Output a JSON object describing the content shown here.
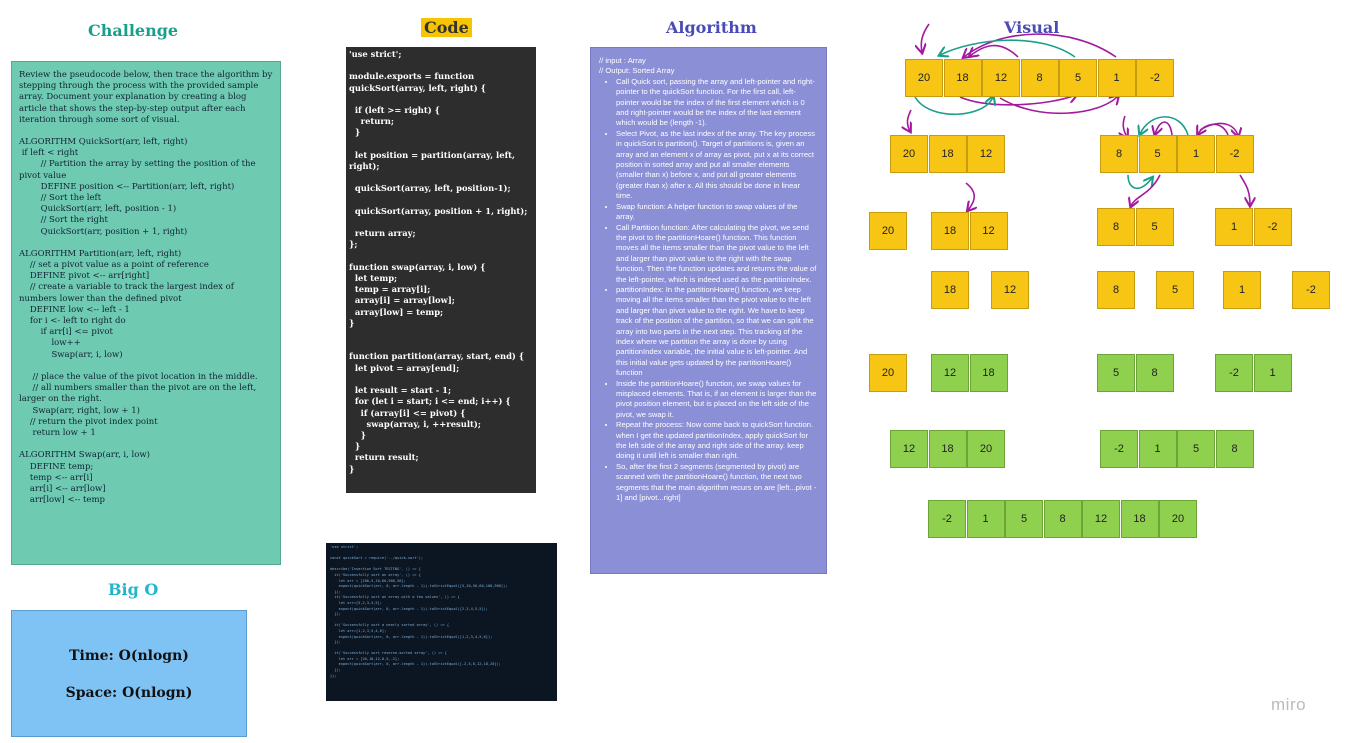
{
  "headings": {
    "challenge": "Challenge",
    "code": "Code",
    "algorithm": "Algorithm",
    "visual": "Visual",
    "bigo": "Big O"
  },
  "challenge": {
    "intro": "Review the pseudocode below, then trace the algorithm by stepping through the process with the provided sample array. Document your explanation by creating a blog article that shows the step-by-step output after each iteration through some sort of visual.",
    "quicksort": "ALGORITHM QuickSort(arr, left, right)\n if left < right\n        // Partition the array by setting the position of the pivot value\n        DEFINE position <-- Partition(arr, left, right)\n        // Sort the left\n        QuickSort(arr, left, position - 1)\n        // Sort the right\n        QuickSort(arr, position + 1, right)",
    "partition": "ALGORITHM Partition(arr, left, right)\n    // set a pivot value as a point of reference\n    DEFINE pivot <-- arr[right]\n    // create a variable to track the largest index of numbers lower than the defined pivot\n    DEFINE low <-- left - 1\n    for i <- left to right do\n        if arr[i] <= pivot\n            low++\n            Swap(arr, i, low)\n\n     // place the value of the pivot location in the middle.\n     // all numbers smaller than the pivot are on the left, larger on the right.\n     Swap(arr, right, low + 1)\n    // return the pivot index point\n     return low + 1",
    "swap": "ALGORITHM Swap(arr, i, low)\n    DEFINE temp;\n    temp <-- arr[i]\n    arr[i] <-- arr[low]\n    arr[low] <-- temp"
  },
  "bigo": {
    "time": "Time: O(nlogn)",
    "space": "Space: O(nlogn)"
  },
  "code": "'use strict';\n\nmodule.exports = function quickSort(array, left, right) {\n\n  if (left >= right) {\n    return;\n  }\n\n  let position = partition(array, left, right);\n\n  quickSort(array, left, position-1);\n\n  quickSort(array, position + 1, right);\n\n  return array;\n};\n\nfunction swap(array, i, low) {\n  let temp;\n  temp = array[i];\n  array[i] = array[low];\n  array[low] = temp;\n}\n\n\nfunction partition(array, start, end) {\n  let pivot = array[end];\n\n  let result = start - 1;\n  for (let i = start; i <= end; i++) {\n    if (array[i] <= pivot) {\n      swap(array, i, ++result);\n    }\n  }\n  return result;\n}",
  "test_code": "'use strict';\n\nconst quickSort = require('../quick-sort');\n\ndescribe('Insertion Sort TESTING', () => {\n  it('Successfully sort an array', () => {\n    let arr = [100,5,10,60,900,50];\n    expect(quickSort(arr, 0, arr.length - 1)).toStrictEqual([5,10,50,60,100,900]);\n  });\n  it('Successfully sort an array with a few values', () => {\n    let arr=[5,2,3,4,5];\n    expect(quickSort(arr, 0, arr.length - 1)).toStrictEqual([2,3,4,5,5]);\n  });\n\n  it('Successfully sort a nearly sorted array', () => {\n    let arr=[1,2,3,5,4,6];\n    expect(quickSort(arr, 0, arr.length - 1)).toStrictEqual([1,2,3,4,5,6]);\n  });\n\n  it('Successfully sort reverse-sorted array', () => {\n    let arr = [20,18,12,8,5,-2];\n    expect(quickSort(arr, 0, arr.length - 1)).toStrictEqual([-2,5,8,12,18,20]);\n  });\n});",
  "algorithm": {
    "input": "// input : Array",
    "output": "// Output: Sorted Array",
    "steps": [
      "Call Quick sort, passing the array and left-pointer and right-pointer to the quickSort function. For the first call, left-pointer would be the index of the first element which is 0 and right-pointer would be the index of the last element which would be (length -1).",
      "Select Pivot, as the last index of the array. The key process in quickSort is partition(). Target of partitions is, given an array and an element x of array as pivot, put x at its correct position in sorted array and put all smaller elements (smaller than x) before x, and put all greater elements (greater than x) after x. All this should be done in linear time.",
      "Swap function: A helper function to swap values of the array.",
      "Call Partition function: After calculating the pivot, we send the pivot to the partitionHoare() function. This function moves all the items smaller than the pivot value to the left and larger than pivot value to the right with the swap function. Then the function updates and returns the value of the left-pointer, which is indeed used as the partitionIndex.",
      "partitionIndex: In the partitionHoare() function, we keep moving all the items smaller than the pivot value to the left and larger than pivot value to the right. We have to keep track of the position of the partition, so that we can split the array into two parts in the next step. This tracking of the index where we partition the array is done by using partitionIndex variable, the initial value is left-pointer. And this initial value gets updated by the partitionHoare() function",
      "Inside the partitionHoare() function, we swap values for misplaced elements. That is, if an element is larger than the pivot position element, but is placed on the left side of the pivot, we swap it.",
      "Repeat the process: Now come back to quickSort function. when I get the updated partitionIndex, apply quickSort for the left side of the array and right side of the array. keep doing it until left is smaller than right.",
      "So, after the first 2 segments (segmented by pivot) are scanned with the partitionHoare() function, the next two segments that the main algorithm recurs on are [left...pivot - 1] and [pivot...right]"
    ]
  },
  "visual": {
    "colors": {
      "yellow": "#f7c514",
      "green": "#8fd14f",
      "teal_arrow": "#1aa08a",
      "purple_arrow": "#a21a9e"
    },
    "rows": [
      {
        "name": "initial",
        "color": "yellow",
        "values": [
          "20",
          "18",
          "12",
          "8",
          "5",
          "1",
          "-2"
        ]
      },
      {
        "name": "split-left",
        "color": "yellow",
        "values": [
          "20",
          "18",
          "12"
        ]
      },
      {
        "name": "split-right",
        "color": "yellow",
        "values": [
          "8",
          "5",
          "1",
          "-2"
        ]
      },
      {
        "name": "level2-a",
        "color": "yellow",
        "values": [
          "20"
        ]
      },
      {
        "name": "level2-b",
        "color": "yellow",
        "values": [
          "18",
          "12"
        ]
      },
      {
        "name": "level2-c",
        "color": "yellow",
        "values": [
          "8",
          "5"
        ]
      },
      {
        "name": "level2-d",
        "color": "yellow",
        "values": [
          "1",
          "-2"
        ]
      },
      {
        "name": "level3-a",
        "color": "yellow",
        "values": [
          "18"
        ]
      },
      {
        "name": "level3-b",
        "color": "yellow",
        "values": [
          "12"
        ]
      },
      {
        "name": "level3-c",
        "color": "yellow",
        "values": [
          "8"
        ]
      },
      {
        "name": "level3-d",
        "color": "yellow",
        "values": [
          "5"
        ]
      },
      {
        "name": "level3-e",
        "color": "yellow",
        "values": [
          "1"
        ]
      },
      {
        "name": "level3-f",
        "color": "yellow",
        "values": [
          "-2"
        ]
      },
      {
        "name": "merge1-a",
        "color": "yellow",
        "values": [
          "20"
        ]
      },
      {
        "name": "merge1-b",
        "color": "green",
        "values": [
          "12",
          "18"
        ]
      },
      {
        "name": "merge1-c",
        "color": "green",
        "values": [
          "5",
          "8"
        ]
      },
      {
        "name": "merge1-d",
        "color": "green",
        "values": [
          "-2",
          "1"
        ]
      },
      {
        "name": "merge2-a",
        "color": "green",
        "values": [
          "12",
          "18",
          "20"
        ]
      },
      {
        "name": "merge2-b",
        "color": "green",
        "values": [
          "-2",
          "1",
          "5",
          "8"
        ]
      },
      {
        "name": "sorted",
        "color": "green",
        "values": [
          "-2",
          "1",
          "5",
          "8",
          "12",
          "18",
          "20"
        ]
      }
    ]
  },
  "watermark": "miro"
}
